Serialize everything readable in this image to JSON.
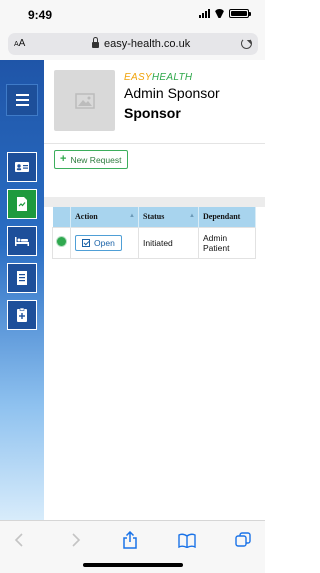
{
  "status_bar": {
    "time": "9:49"
  },
  "browser": {
    "text_size_label": "AA",
    "url": "easy-health.co.uk"
  },
  "brand": {
    "easy": "EASY",
    "health": "HEALTH"
  },
  "user": {
    "name": "Admin Sponsor",
    "role": "Sponsor"
  },
  "actions": {
    "new_request_label": "New Request"
  },
  "table": {
    "columns": [
      "Action",
      "Status",
      "Dependant"
    ],
    "rows": [
      {
        "status_dot_color": "#2fa84f",
        "action_label": "Open",
        "status": "Initiated",
        "dependant": "Admin Patient"
      }
    ]
  },
  "sidebar": {
    "items": [
      {
        "icon": "menu-icon"
      },
      {
        "icon": "id-card-icon"
      },
      {
        "icon": "document-icon"
      },
      {
        "icon": "hospital-bed-icon"
      },
      {
        "icon": "list-icon"
      },
      {
        "icon": "clipboard-plus-icon"
      }
    ]
  },
  "colors": {
    "sidebar_top": "#1f55a8",
    "accent_green": "#2ea84a",
    "brand_orange": "#f0a30a",
    "table_header": "#a8d4ee"
  }
}
